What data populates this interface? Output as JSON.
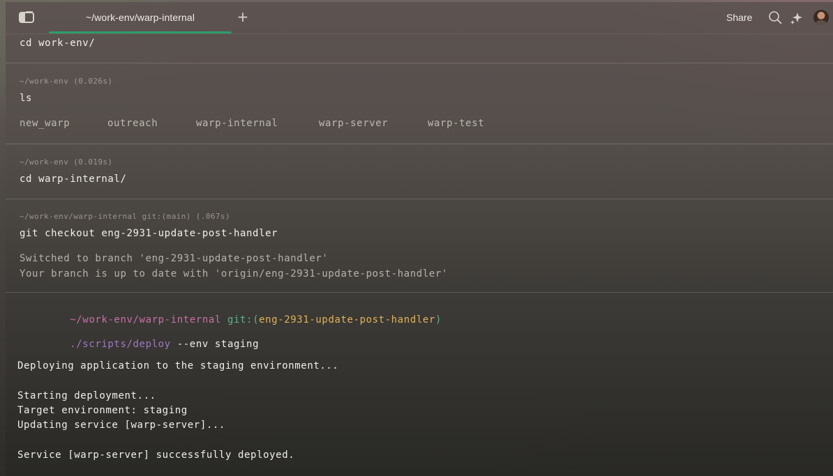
{
  "titlebar": {
    "tab_label": "~/work-env/warp-internal",
    "new_tab": "+",
    "share": "Share"
  },
  "blocks": [
    {
      "command": "cd work-env/"
    },
    {
      "prompt": "~/work-env (0.026s)",
      "command": "ls",
      "ls_items": [
        "new_warp",
        "outreach",
        "warp-internal",
        "warp-server",
        "warp-test"
      ]
    },
    {
      "prompt": "~/work-env (0.019s)",
      "command": "cd warp-internal/"
    },
    {
      "prompt": "~/work-env/warp-internal git:(main) (.067s)",
      "command": "git checkout eng-2931-update-post-handler",
      "output": [
        "Switched to branch 'eng-2931-update-post-handler'",
        "Your branch is up to date with 'origin/eng-2931-update-post-handler'"
      ]
    }
  ],
  "active": {
    "prompt_path": "~/work-env/warp-internal",
    "prompt_git": " git:(",
    "prompt_branch": "eng-2931-update-post-handler",
    "prompt_close": ")",
    "cmd_script": "./scripts/deploy",
    "cmd_args": " --env staging",
    "output": [
      "Deploying application to the staging environment...",
      "Starting deployment...",
      "Target environment: staging",
      "Updating service [warp-server]...",
      "Service [warp-server] successfully deployed."
    ]
  },
  "colors": {
    "tab_indicator": "#2e9d68",
    "prompt_path": "#c86fa6",
    "prompt_git": "#5fb38c",
    "prompt_branch": "#e0b35a",
    "script": "#9f79c2"
  }
}
